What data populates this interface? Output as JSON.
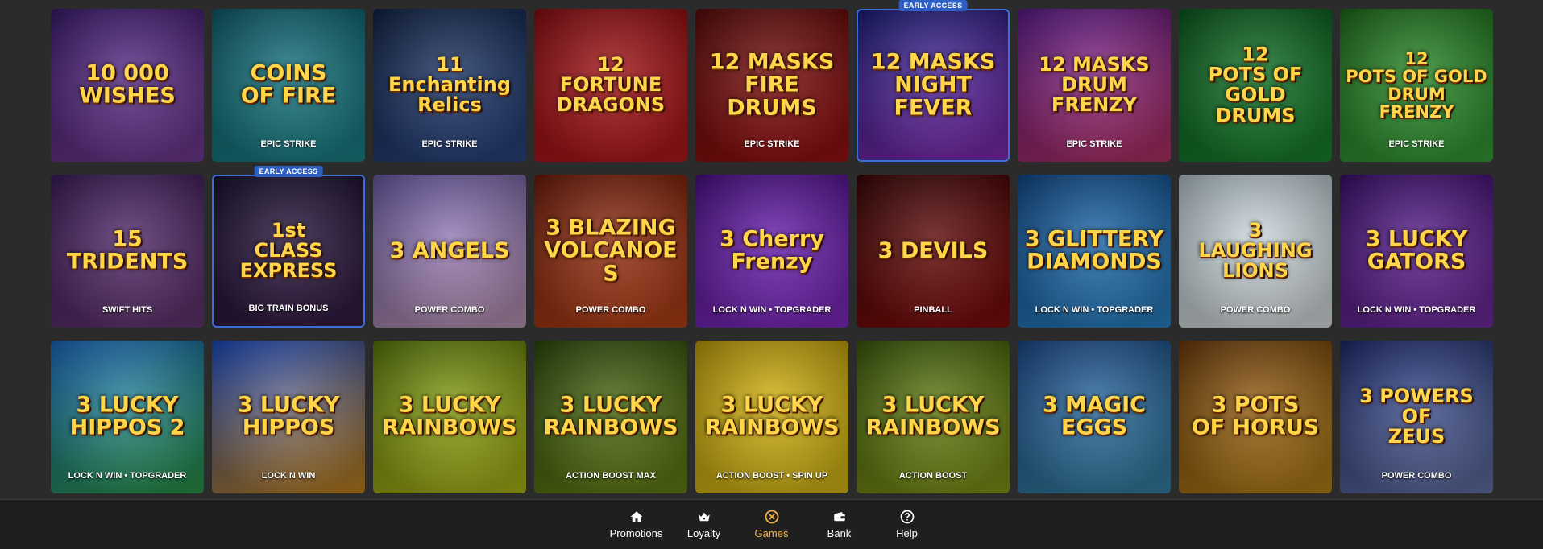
{
  "early_access_label": "EARLY ACCESS",
  "games": [
    {
      "title": "10 000\nWISHES",
      "sub": "",
      "colors": [
        "#3b1a6e",
        "#7a3f9d"
      ],
      "early": false
    },
    {
      "title": "COINS\nOF FIRE",
      "sub": "EPIC STRIKE",
      "colors": [
        "#0f5e6e",
        "#1c8a8f"
      ],
      "early": false
    },
    {
      "title": "11\nEnchanting\nRelics",
      "sub": "EPIC STRIKE",
      "colors": [
        "#0f2245",
        "#2e4a8a"
      ],
      "early": false
    },
    {
      "title": "12\nFORTUNE\nDRAGONS",
      "sub": "",
      "colors": [
        "#8a0d12",
        "#c21a1e"
      ],
      "early": false
    },
    {
      "title": "12 MASKS\nFIRE DRUMS",
      "sub": "EPIC STRIKE",
      "colors": [
        "#5a0a0a",
        "#a31212"
      ],
      "early": false
    },
    {
      "title": "12 MASKS\nNIGHT FEVER",
      "sub": "",
      "colors": [
        "#1b1e7a",
        "#8a2fbf"
      ],
      "early": true
    },
    {
      "title": "12 MASKS\nDRUM\nFRENZY",
      "sub": "EPIC STRIKE",
      "colors": [
        "#5b1a8a",
        "#c0336b"
      ],
      "early": false
    },
    {
      "title": "12\nPOTS OF GOLD\nDRUMS",
      "sub": "",
      "colors": [
        "#0a5a1e",
        "#1b8a31"
      ],
      "early": false
    },
    {
      "title": "12\nPOTS OF GOLD\nDRUM\nFRENZY",
      "sub": "EPIC STRIKE",
      "colors": [
        "#1d6e1a",
        "#3aa83a"
      ],
      "early": false
    },
    {
      "title": "15\nTRIDENTS",
      "sub": "SWIFT HITS",
      "colors": [
        "#3b1c5a",
        "#6b3a7a"
      ],
      "early": false
    },
    {
      "title": "1st\nCLASS\nEXPRESS",
      "sub": "BIG TRAIN BONUS",
      "colors": [
        "#1a0f30",
        "#3a1f4a"
      ],
      "early": true
    },
    {
      "title": "3 ANGELS",
      "sub": "POWER COMBO",
      "colors": [
        "#6a5aa8",
        "#c7a0c0"
      ],
      "early": false
    },
    {
      "title": "3 BLAZING\nVOLCANOES",
      "sub": "POWER COMBO",
      "colors": [
        "#6e1b0a",
        "#c2461a"
      ],
      "early": false
    },
    {
      "title": "3 Cherry\nFrenzy",
      "sub": "LOCK N WIN • TOPGRADER",
      "colors": [
        "#4a0f8a",
        "#8a2fd0"
      ],
      "early": false
    },
    {
      "title": "3 DEVILS",
      "sub": "PINBALL",
      "colors": [
        "#3a0505",
        "#8a0d0d"
      ],
      "early": false
    },
    {
      "title": "3 GLITTERY\nDIAMONDS",
      "sub": "LOCK N WIN • TOPGRADER",
      "colors": [
        "#0f4a8a",
        "#2e8ad0"
      ],
      "early": false
    },
    {
      "title": "3\nLAUGHING\nLIONS",
      "sub": "POWER COMBO",
      "colors": [
        "#b8c8cf",
        "#e8eef0"
      ],
      "early": false
    },
    {
      "title": "3 LUCKY\nGATORS",
      "sub": "LOCK N WIN • TOPGRADER",
      "colors": [
        "#3a0f6e",
        "#7a2faa"
      ],
      "early": false
    },
    {
      "title": "3 LUCKY\nHIPPOS 2",
      "sub": "LOCK N WIN • TOPGRADER",
      "colors": [
        "#1a6ac2",
        "#2ea04a"
      ],
      "early": false
    },
    {
      "title": "3 LUCKY\nHIPPOS",
      "sub": "LOCK N WIN",
      "colors": [
        "#1a4ac2",
        "#d08a1a"
      ],
      "early": false
    },
    {
      "title": "3 LUCKY\nRAINBOWS",
      "sub": "",
      "colors": [
        "#5a7a0a",
        "#b8c21a"
      ],
      "early": false
    },
    {
      "title": "3 LUCKY\nRAINBOWS",
      "sub": "ACTION BOOST MAX",
      "colors": [
        "#2a4a0a",
        "#6e8a1a"
      ],
      "early": false
    },
    {
      "title": "3 LUCKY\nRAINBOWS",
      "sub": "ACTION BOOST • SPIN UP",
      "colors": [
        "#c2a00a",
        "#e8c81a"
      ],
      "early": false
    },
    {
      "title": "3 LUCKY\nRAINBOWS",
      "sub": "ACTION BOOST",
      "colors": [
        "#3a5a0a",
        "#8aa01a"
      ],
      "early": false
    },
    {
      "title": "3 MAGIC\nEGGS",
      "sub": "",
      "colors": [
        "#1a4a8a",
        "#3a8ab0"
      ],
      "early": false
    },
    {
      "title": "3 POTS\nOF HORUS",
      "sub": "",
      "colors": [
        "#6e3a0a",
        "#c28a1a"
      ],
      "early": false
    },
    {
      "title": "3 POWERS\nOF\nZEUS",
      "sub": "POWER COMBO",
      "colors": [
        "#1a2a6e",
        "#6a7ab0"
      ],
      "early": false
    }
  ],
  "nav": [
    {
      "label": "Promotions",
      "icon": "home-icon",
      "active": false
    },
    {
      "label": "Loyalty",
      "icon": "crown-icon",
      "active": false
    },
    {
      "label": "Games",
      "icon": "casino-chip-icon",
      "active": true
    },
    {
      "label": "Bank",
      "icon": "wallet-icon",
      "active": false
    },
    {
      "label": "Help",
      "icon": "help-icon",
      "active": false
    }
  ],
  "colors": {
    "accent": "#f5b44a",
    "early_badge": "#2e5fc4",
    "nav_bg": "#1f1f1f",
    "page_bg": "#2b2b2b"
  }
}
